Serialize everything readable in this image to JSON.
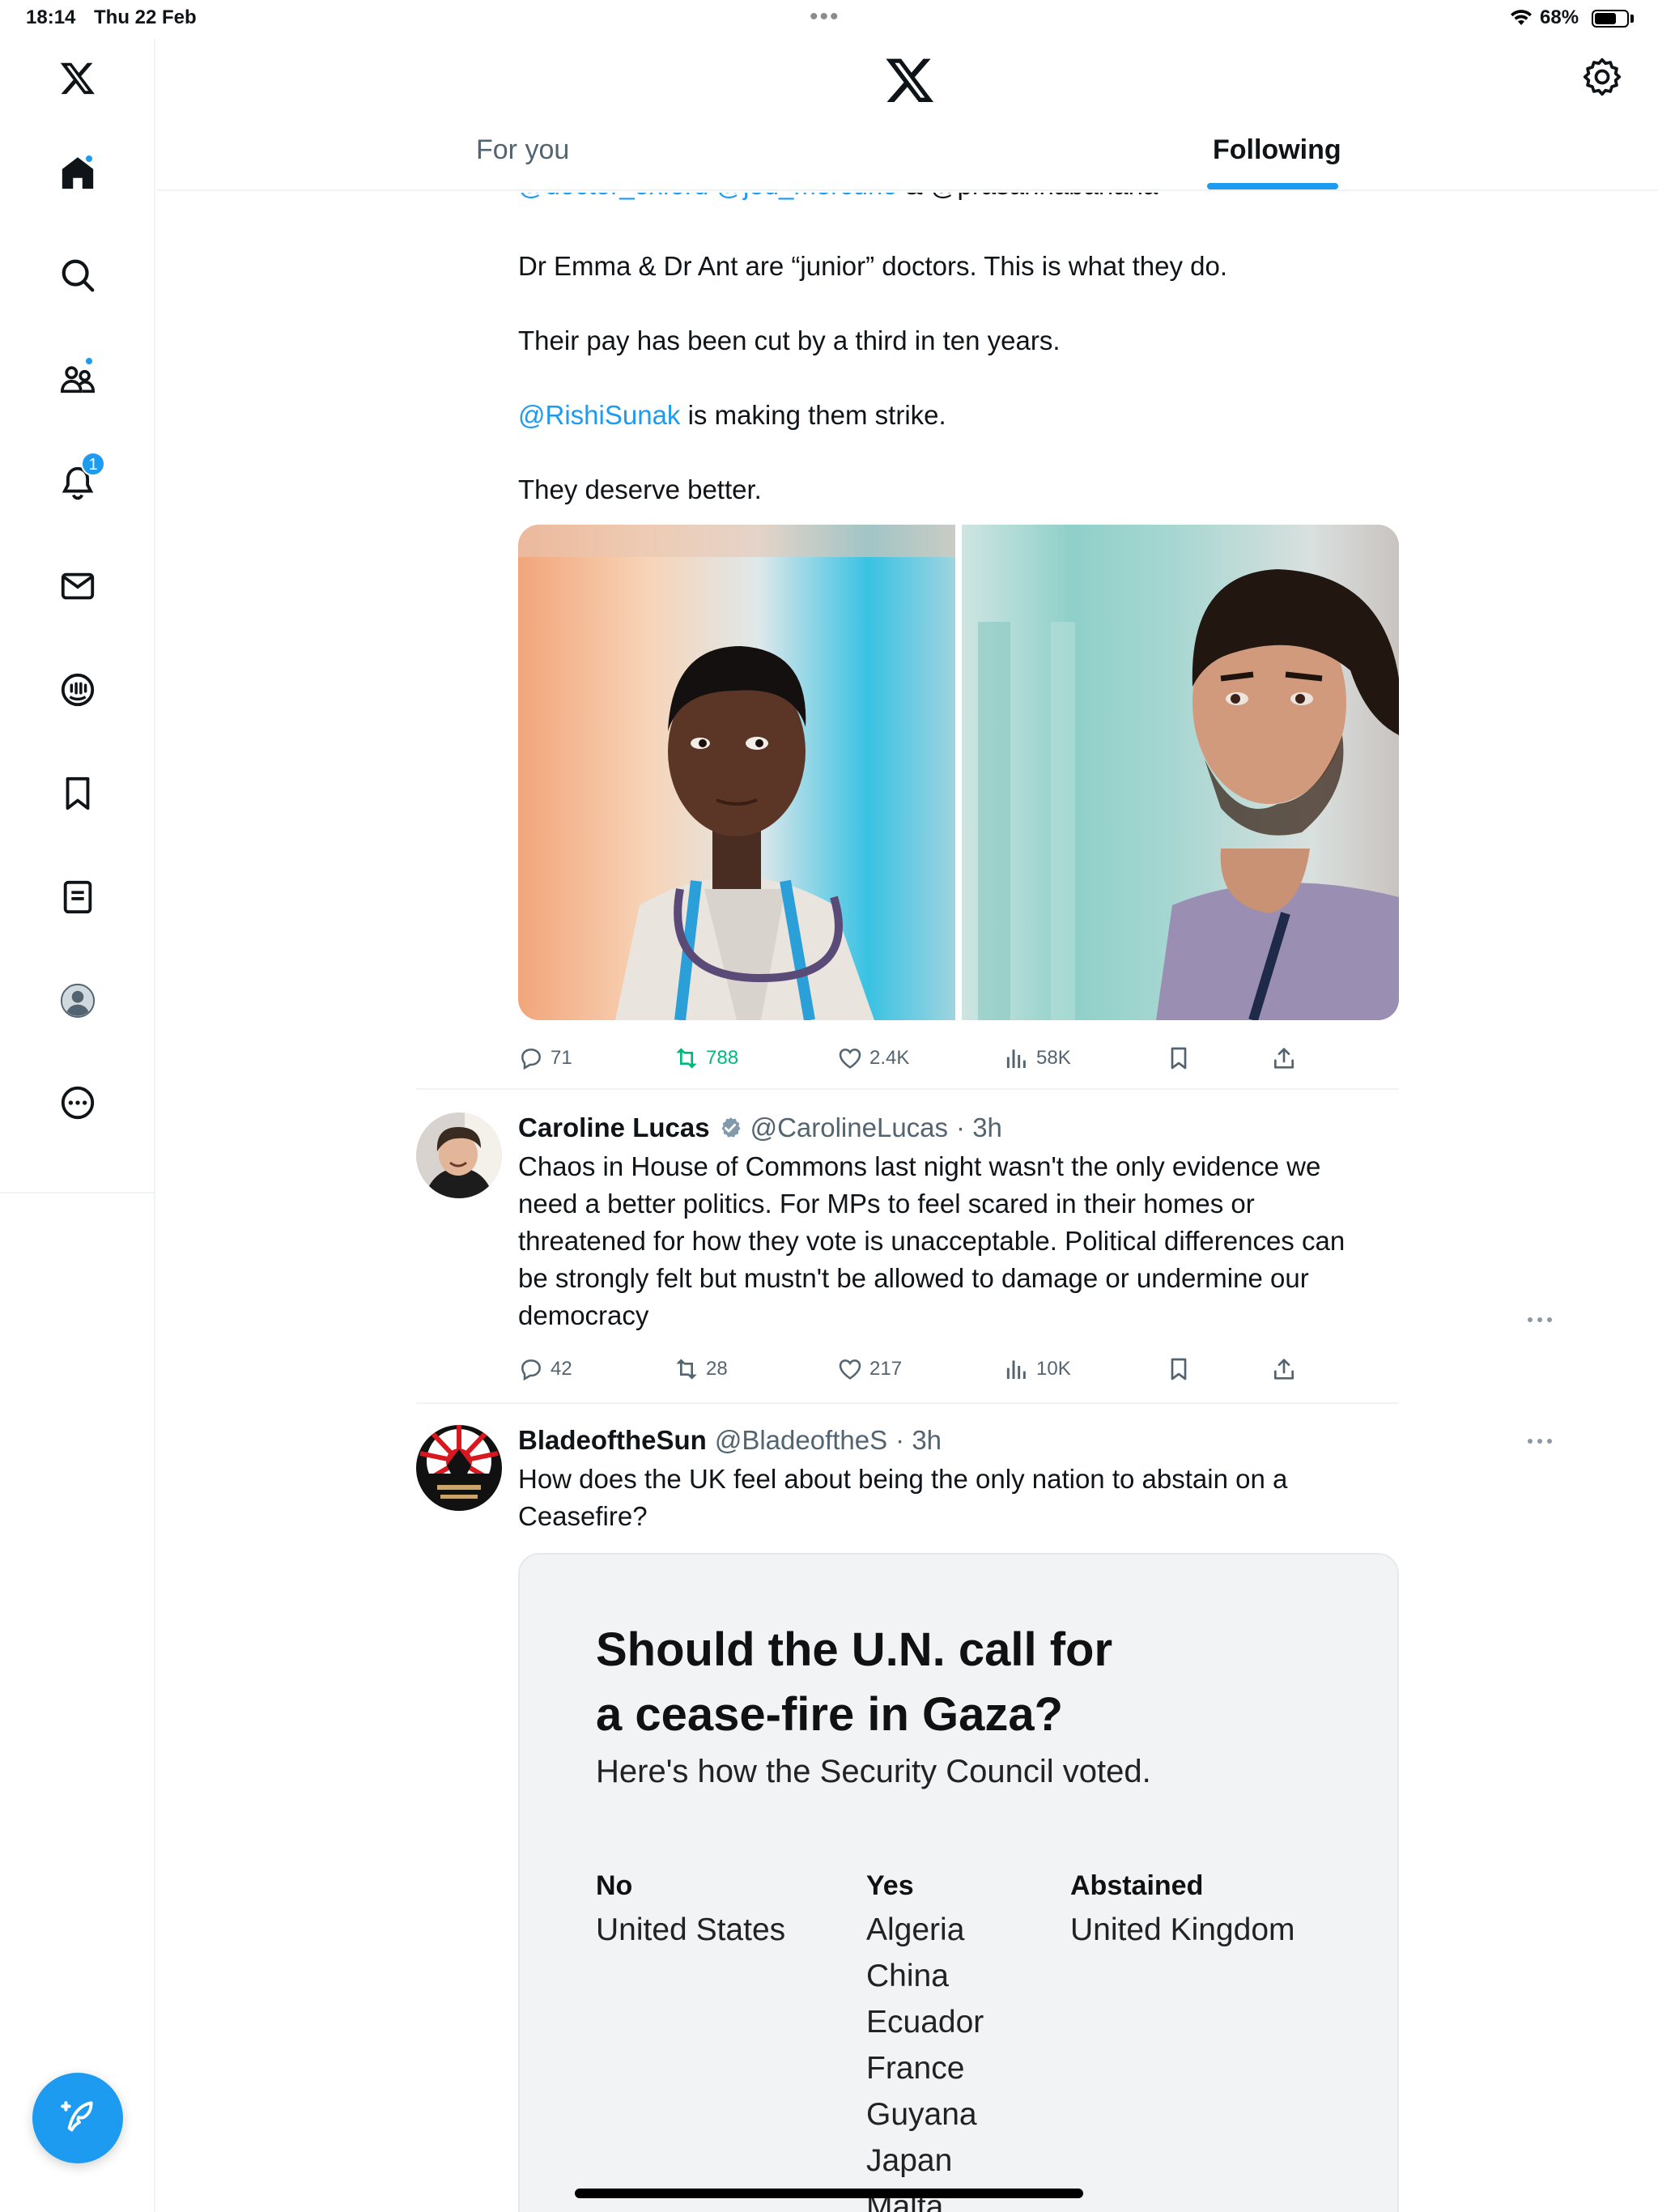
{
  "status_bar": {
    "time": "18:14",
    "date": "Thu 22 Feb",
    "battery_pct": "68%",
    "battery_level": 0.68
  },
  "sidebar": {
    "items": [
      {
        "icon": "x-logo-icon"
      },
      {
        "icon": "home-icon",
        "dot": true
      },
      {
        "icon": "search-icon"
      },
      {
        "icon": "communities-icon",
        "dot": true
      },
      {
        "icon": "notifications-icon",
        "badge": "1"
      },
      {
        "icon": "messages-icon"
      },
      {
        "icon": "grok-icon"
      },
      {
        "icon": "bookmarks-icon"
      },
      {
        "icon": "lists-icon"
      },
      {
        "icon": "profile-icon"
      },
      {
        "icon": "more-icon"
      }
    ],
    "compose_icon": "compose-icon"
  },
  "header": {
    "tabs": [
      {
        "label": "For you",
        "active": false
      },
      {
        "label": "Following",
        "active": true
      }
    ]
  },
  "tweets": [
    {
      "partial_top": {
        "mentions": "@doctor_oxford @jed_mercurio",
        "rest": "& @prasannabanana"
      },
      "lines": [
        "Dr Emma & Dr Ant are “junior” doctors. This is what they do.",
        "Their pay has been cut by a third in ten years.",
        "is making them strike.",
        "They deserve better."
      ],
      "mention": "@RishiSunak",
      "stats": {
        "replies": "71",
        "retweets": "788",
        "likes": "2.4K",
        "views": "58K"
      }
    },
    {
      "name": "Caroline Lucas",
      "verified": true,
      "handle": "@CarolineLucas",
      "time": "· 3h",
      "text_lines": [
        "Chaos in House of Commons last night wasn't the only evidence we",
        "need a better politics. For MPs to feel scared in their homes or",
        "threatened for how they vote is unacceptable. Political differences can",
        "be strongly felt but mustn't be allowed to damage or undermine our",
        "democracy"
      ],
      "stats": {
        "replies": "42",
        "retweets": "28",
        "likes": "217",
        "views": "10K"
      }
    },
    {
      "name": "BladeoftheSun",
      "handle": "@BladeoftheS",
      "time": "· 3h",
      "text_lines": [
        "How does the UK feel about being the only nation to abstain on a",
        "Ceasefire?"
      ],
      "card": {
        "title_line1": "Should the U.N. call for",
        "title_line2": "a cease-fire in Gaza?",
        "subtitle": "Here's how the Security Council voted.",
        "columns": [
          {
            "head": "No",
            "items": [
              "United States"
            ]
          },
          {
            "head": "Yes",
            "items": [
              "Algeria",
              "China",
              "Ecuador",
              "France",
              "Guyana",
              "Japan",
              "Malta"
            ]
          },
          {
            "head": "Abstained",
            "items": [
              "United Kingdom"
            ]
          }
        ]
      }
    }
  ]
}
